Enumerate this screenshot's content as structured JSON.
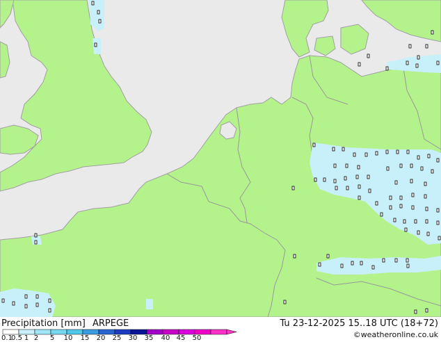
{
  "title": "Precipitation [mm]",
  "model": "ARPEGE",
  "datetime": "Tu 23-12-2025 15..18 UTC (18+72)",
  "credit": "©weatheronline.co.uk",
  "legend": {
    "ticks": [
      "0.1",
      "0.5",
      "1",
      "2",
      "5",
      "10",
      "15",
      "20",
      "25",
      "30",
      "35",
      "40",
      "45",
      "50"
    ],
    "colors": [
      "#ffffff",
      "#c8f0fa",
      "#a0e6f6",
      "#78d8f0",
      "#50c8ec",
      "#3c9ce0",
      "#2a64d2",
      "#1e3cc0",
      "#0a1496",
      "#a000c8",
      "#c800c8",
      "#dc00dc",
      "#f000c8",
      "#ff32c8"
    ]
  },
  "colors": {
    "sea": "#eaeaea",
    "land": "#b4f28c",
    "coast": "#a0a0a0",
    "border": "#999999",
    "precip_light": "#c8f0fa"
  }
}
